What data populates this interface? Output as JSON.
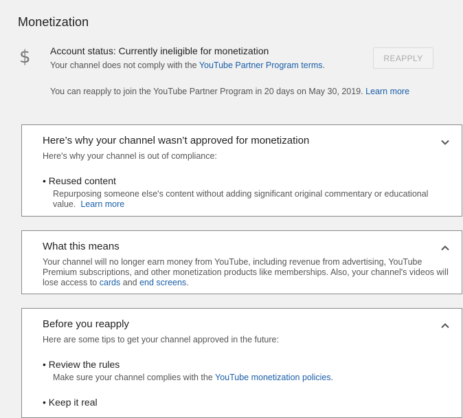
{
  "page": {
    "title": "Monetization"
  },
  "account": {
    "status": "Account status: Currently ineligible for monetization",
    "sub_prefix": "Your channel does not comply with the ",
    "sub_link": "YouTube Partner Program terms",
    "sub_suffix": ".",
    "reapply_label": "REAPPLY",
    "note": "You can reapply to join the YouTube Partner Program in 20 days on May 30, 2019.",
    "note_link": "Learn more"
  },
  "cards": {
    "why": {
      "title": "Here’s why your channel wasn’t approved for monetization",
      "subtitle": "Here's why your channel is out of compliance:",
      "bullet_title": "Reused content",
      "bullet_desc": "Repurposing someone else's content without adding significant original commentary or educational value.",
      "bullet_link": "Learn more",
      "expanded": false
    },
    "means": {
      "title": "What this means",
      "text": "Your channel will no longer earn money from YouTube, including revenue from advertising, YouTube Premium subscriptions, and other monetization products like memberships. Also, your channel's videos will lose access to ",
      "link_cards": "cards",
      "and": " and ",
      "link_end": "end screens",
      "end": ".",
      "expanded": true
    },
    "before": {
      "title": "Before you reapply",
      "subtitle": "Here are some tips to get your channel approved in the future:",
      "tips": [
        {
          "title": "Review the rules",
          "desc_prefix": "Make sure your channel complies with the ",
          "desc_link": "YouTube monetization policies",
          "desc_suffix": "."
        },
        {
          "title": "Keep it real"
        }
      ],
      "expanded": true
    }
  }
}
